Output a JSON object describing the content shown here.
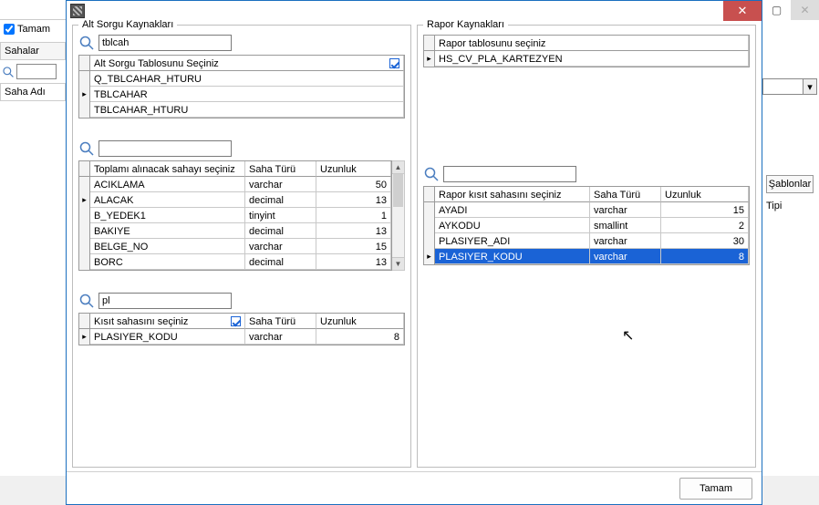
{
  "bgLeft": {
    "checkLabel": "Tamam",
    "headerLabel": "Sahalar",
    "cellLabel": "Saha Adı"
  },
  "bgRight": {
    "sablonlar": "Şablonlar",
    "tipi": "Tipi"
  },
  "leftPanel": {
    "legend": "Alt Sorgu Kaynakları",
    "search1": "tblcah",
    "tableSelect": {
      "header": "Alt Sorgu Tablosunu Seçiniz",
      "rows": [
        "Q_TBLCAHAR_HTURU",
        "TBLCAHAR",
        "TBLCAHAR_HTURU"
      ],
      "currentIndex": 1
    },
    "search2": "",
    "sumFields": {
      "headers": [
        "Toplamı alınacak sahayı seçiniz",
        "Saha Türü",
        "Uzunluk"
      ],
      "rows": [
        {
          "n": "ACIKLAMA",
          "t": "varchar",
          "l": 50
        },
        {
          "n": "ALACAK",
          "t": "decimal",
          "l": 13
        },
        {
          "n": "B_YEDEK1",
          "t": "tinyint",
          "l": 1
        },
        {
          "n": "BAKIYE",
          "t": "decimal",
          "l": 13
        },
        {
          "n": "BELGE_NO",
          "t": "varchar",
          "l": 15
        },
        {
          "n": "BORC",
          "t": "decimal",
          "l": 13
        }
      ],
      "currentIndex": 1
    },
    "search3": "pl",
    "constraintFields": {
      "headers": [
        "Kısıt sahasını seçiniz",
        "Saha Türü",
        "Uzunluk"
      ],
      "rows": [
        {
          "n": "PLASIYER_KODU",
          "t": "varchar",
          "l": 8
        }
      ],
      "currentIndex": 0
    }
  },
  "rightPanel": {
    "legend": "Rapor Kaynakları",
    "tableSelect": {
      "header": "Rapor tablosunu seçiniz",
      "rows": [
        "HS_CV_PLA_KARTEZYEN"
      ],
      "currentIndex": 0
    },
    "search1": "",
    "constraintFields": {
      "headers": [
        "Rapor kısıt sahasını seçiniz",
        "Saha Türü",
        "Uzunluk"
      ],
      "rows": [
        {
          "n": "AYADI",
          "t": "varchar",
          "l": 15
        },
        {
          "n": "AYKODU",
          "t": "smallint",
          "l": 2
        },
        {
          "n": "PLASIYER_ADI",
          "t": "varchar",
          "l": 30
        },
        {
          "n": "PLASIYER_KODU",
          "t": "varchar",
          "l": 8
        }
      ],
      "currentIndex": 3,
      "selectedIndex": 3
    }
  },
  "footer": {
    "ok": "Tamam"
  }
}
